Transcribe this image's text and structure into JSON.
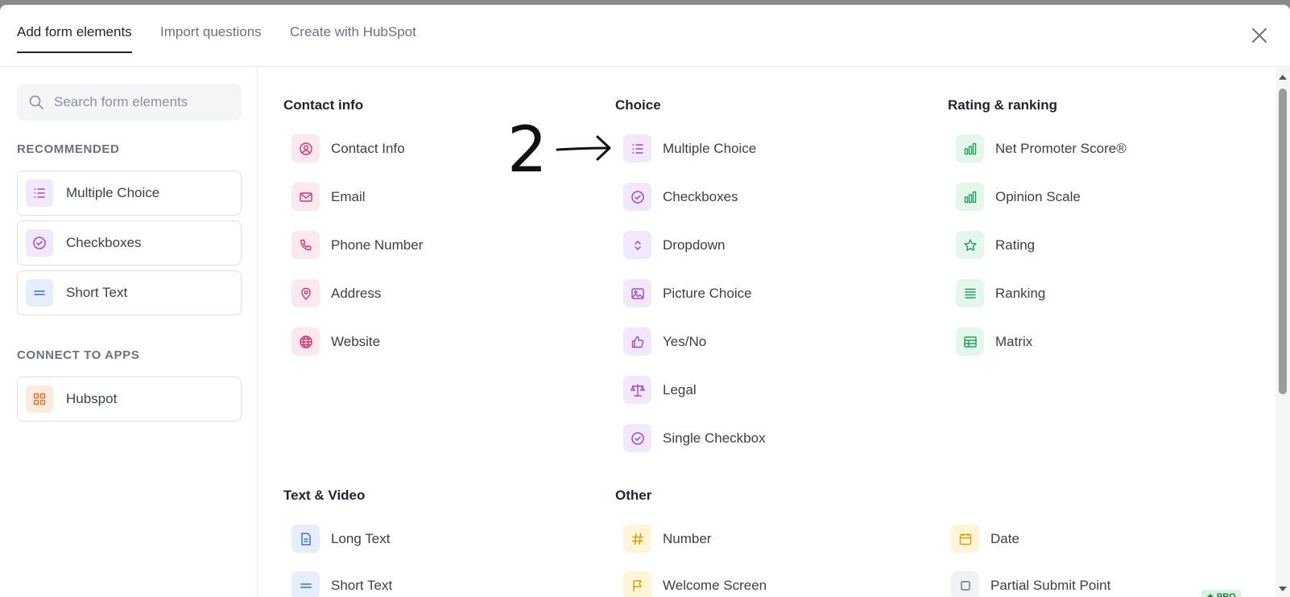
{
  "tabs": [
    {
      "label": "Add form elements"
    },
    {
      "label": "Import questions"
    },
    {
      "label": "Create with HubSpot"
    }
  ],
  "search": {
    "placeholder": "Search form elements"
  },
  "sidebar": {
    "recommended_label": "RECOMMENDED",
    "recommended": [
      {
        "label": "Multiple Choice",
        "icon": "list-icon"
      },
      {
        "label": "Checkboxes",
        "icon": "check-circle-icon"
      },
      {
        "label": "Short Text",
        "icon": "equals-icon"
      }
    ],
    "connect_label": "CONNECT TO APPS",
    "apps": [
      {
        "label": "Hubspot",
        "icon": "grid-icon"
      }
    ]
  },
  "columns": {
    "contact": {
      "title": "Contact info",
      "items": [
        "Contact Info",
        "Email",
        "Phone Number",
        "Address",
        "Website"
      ]
    },
    "choice": {
      "title": "Choice",
      "items": [
        "Multiple Choice",
        "Checkboxes",
        "Dropdown",
        "Picture Choice",
        "Yes/No",
        "Legal",
        "Single Checkbox"
      ]
    },
    "rating": {
      "title": "Rating & ranking",
      "items": [
        "Net Promoter Score®",
        "Opinion Scale",
        "Rating",
        "Ranking",
        "Matrix"
      ]
    },
    "text_video": {
      "title": "Text & Video",
      "items": [
        "Long Text",
        "Short Text"
      ]
    },
    "other": {
      "title": "Other",
      "items": [
        "Number",
        "Welcome Screen"
      ],
      "items2": [
        "Date",
        "Partial Submit Point"
      ],
      "pro_badge": "★ PRO"
    }
  },
  "annotation": {
    "number": "2"
  },
  "colors": {
    "pink_icon": "#d6336c",
    "purple_icon": "#9b4bd6",
    "green_icon": "#22a05a",
    "blue_icon": "#3b6fd8",
    "yellow_icon": "#d4a106",
    "orange_icon": "#e8702a"
  }
}
